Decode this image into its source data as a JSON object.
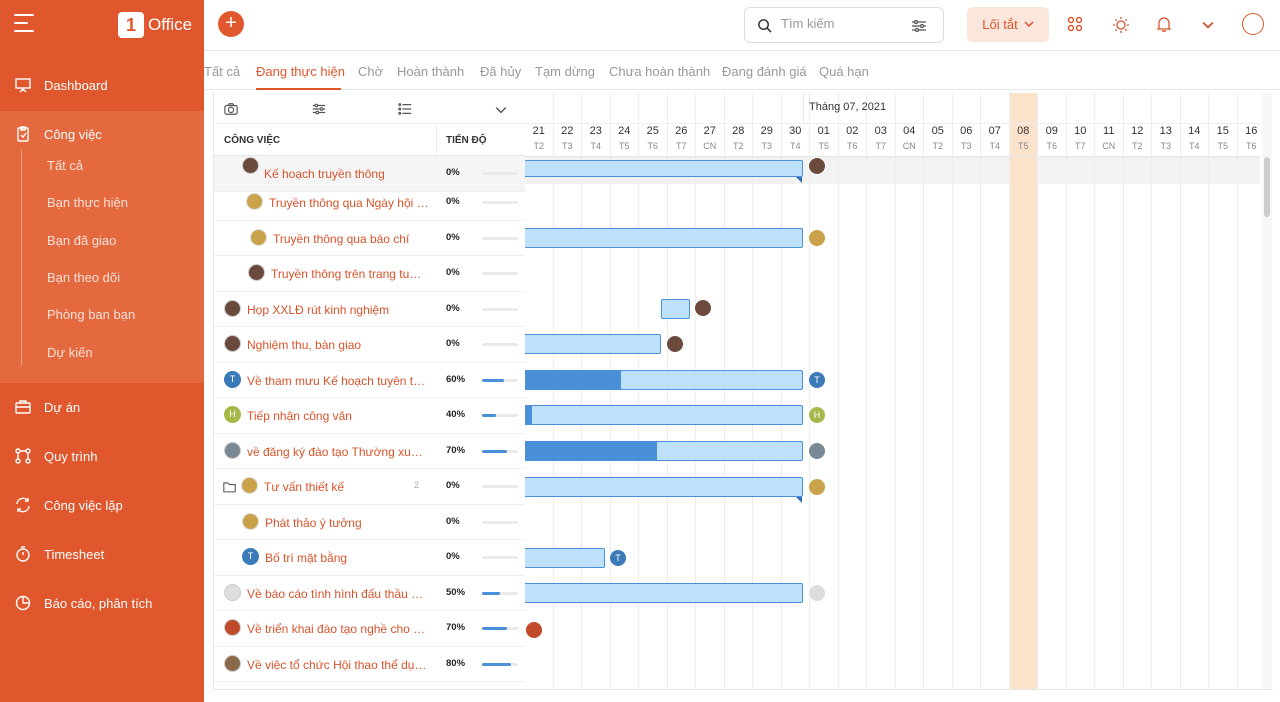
{
  "app": {
    "logo_text": "Office"
  },
  "sidebar": {
    "items": [
      {
        "label": "Dashboard",
        "icon": "presentation-icon"
      },
      {
        "label": "Công việc",
        "icon": "clipboard-icon"
      },
      {
        "label": "Dự án",
        "icon": "briefcase-icon"
      },
      {
        "label": "Quy trình",
        "icon": "flow-icon"
      },
      {
        "label": "Công việc lặp",
        "icon": "repeat-icon"
      },
      {
        "label": "Timesheet",
        "icon": "stopwatch-icon"
      },
      {
        "label": "Báo cáo, phân tích",
        "icon": "pie-chart-icon"
      }
    ],
    "sub_items": [
      "Tất cả",
      "Bạn thực hiện",
      "Bạn đã giao",
      "Bạn theo dõi",
      "Phòng ban bạn",
      "Dự kiến"
    ]
  },
  "topbar": {
    "add_label": "+",
    "search_placeholder": "Tìm kiếm",
    "shortcut_label": "Lối tắt"
  },
  "tabs": [
    "Tất cả",
    "Đang thực hiện",
    "Chờ",
    "Hoàn thành",
    "Đã hủy",
    "Tạm dừng",
    "Chưa hoàn thành",
    "Đang đánh giá",
    "Quá hạn"
  ],
  "active_tab": "Đang thực hiện",
  "task_table": {
    "col_task": "CÔNG VIỆC",
    "col_progress": "TIẾN ĐỘ",
    "rows": [
      {
        "name": "Kế hoạch truyền thông",
        "progress": "0%",
        "progress_value": 0
      },
      {
        "name": "Truyền thông qua Ngày hội tuyển dụng",
        "progress": "0%",
        "progress_value": 0
      },
      {
        "name": "Truyền thông qua báo chí",
        "progress": "0%",
        "progress_value": 0
      },
      {
        "name": "Truyền thông trên trang tuyển dụng",
        "progress": "0%",
        "progress_value": 0
      },
      {
        "name": "Họp XXLĐ rút kinh nghiệm",
        "progress": "0%",
        "progress_value": 0
      },
      {
        "name": "Nghiệm thu, bàn giao",
        "progress": "0%",
        "progress_value": 0
      },
      {
        "name": "Về tham mưu Kế hoạch tuyên truyền",
        "progress": "60%",
        "progress_value": 60
      },
      {
        "name": "Tiếp nhận công văn",
        "progress": "40%",
        "progress_value": 40
      },
      {
        "name": "về đăng ký đào tạo Thường xuyên",
        "progress": "70%",
        "progress_value": 70
      },
      {
        "name": "Tư vấn thiết kế",
        "progress": "0%",
        "progress_value": 0,
        "count": "2"
      },
      {
        "name": "Phát thảo ý tưởng",
        "progress": "0%",
        "progress_value": 0
      },
      {
        "name": "Bố trí mặt bằng",
        "progress": "0%",
        "progress_value": 0
      },
      {
        "name": "Về báo cáo tình hình đấu thầu quý",
        "progress": "50%",
        "progress_value": 50
      },
      {
        "name": "Về triển khai đào tạo nghề cho người lao động",
        "progress": "70%",
        "progress_value": 70
      },
      {
        "name": "Về việc tổ chức Hội thao thể dục thể thao",
        "progress": "80%",
        "progress_value": 80
      }
    ]
  },
  "gantt": {
    "month_label": "Tháng 07, 2021",
    "days": [
      {
        "d": "21",
        "w": "T2"
      },
      {
        "d": "22",
        "w": "T3"
      },
      {
        "d": "23",
        "w": "T4"
      },
      {
        "d": "24",
        "w": "T5"
      },
      {
        "d": "25",
        "w": "T6"
      },
      {
        "d": "26",
        "w": "T7"
      },
      {
        "d": "27",
        "w": "CN"
      },
      {
        "d": "28",
        "w": "T2"
      },
      {
        "d": "29",
        "w": "T3"
      },
      {
        "d": "30",
        "w": "T4"
      },
      {
        "d": "01",
        "w": "T5"
      },
      {
        "d": "02",
        "w": "T6"
      },
      {
        "d": "03",
        "w": "T7"
      },
      {
        "d": "04",
        "w": "CN"
      },
      {
        "d": "05",
        "w": "T2"
      },
      {
        "d": "06",
        "w": "T3"
      },
      {
        "d": "07",
        "w": "T4"
      },
      {
        "d": "08",
        "w": "T5"
      },
      {
        "d": "09",
        "w": "T6"
      },
      {
        "d": "10",
        "w": "T7"
      },
      {
        "d": "11",
        "w": "CN"
      },
      {
        "d": "12",
        "w": "T2"
      },
      {
        "d": "13",
        "w": "T3"
      },
      {
        "d": "14",
        "w": "T4"
      },
      {
        "d": "15",
        "w": "T5"
      },
      {
        "d": "16",
        "w": "T6"
      }
    ],
    "today": "08",
    "avatar_letters": {
      "t": "T",
      "h": "H"
    }
  },
  "colors": {
    "brand": "#e0572d",
    "bar": "#bde0fb",
    "bar_done": "#4a90d9",
    "today": "#fbe2cb"
  }
}
